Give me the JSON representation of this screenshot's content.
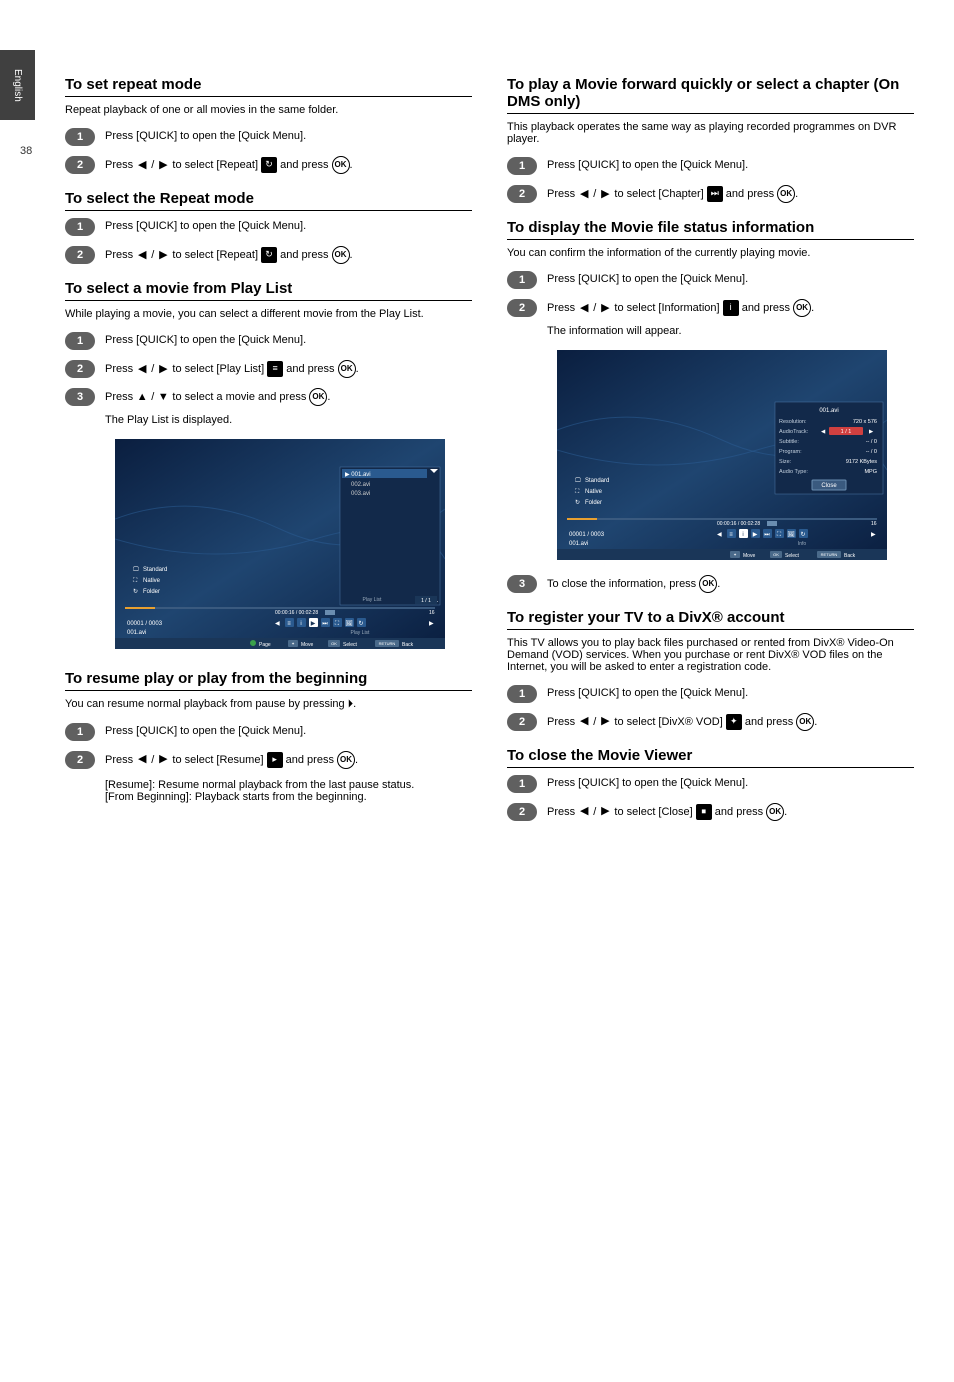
{
  "sidebar": {
    "label": "English",
    "page": "38"
  },
  "left": {
    "sec1": {
      "title": "To set repeat mode",
      "sub": "Repeat playback of one or all movies in the same folder.",
      "s1": "Press [QUICK] to open the [Quick Menu].",
      "s2a": "Press ",
      "s2b": " / ",
      "s2c": " to select [Repeat] ",
      "s2d": " and press "
    },
    "sec2": {
      "title": "To select the Repeat mode",
      "s1": "Press [QUICK] to open the [Quick Menu].",
      "s2a": "Press ",
      "s2b": " / ",
      "s2c": " to select [Repeat] ",
      "s2d": " and press "
    },
    "sec3": {
      "title": "To select a movie from Play List",
      "sub": "While playing a movie, you can select a different movie from the Play List.",
      "s1": "Press [QUICK] to open the [Quick Menu].",
      "s2a": "Press ",
      "s2b": " / ",
      "s2c": " to select [Play List] ",
      "s2d": " and press ",
      "s3a": "Press ",
      "s3b": " / ",
      "s3c": " to select a movie and press ",
      "s3_note": "The Play List is displayed."
    },
    "sec4": {
      "title": "To resume play or play from the beginning",
      "sub": "You can resume normal playback from pause by pressing ⏵.",
      "s1": "Press [QUICK] to open the [Quick Menu].",
      "s2a": "Press ",
      "s2b": " / ",
      "s2c": " to select [Resume] ",
      "s2d": " and press ",
      "note": "[Resume]: Resume normal playback from the last pause status.\n[From Beginning]: Playback starts from the beginning."
    }
  },
  "right": {
    "sec5": {
      "title": "To play a Movie forward quickly or select a chapter (On DMS only)",
      "sub": "This playback operates the same way as playing recorded programmes on DVR player.",
      "s1": "Press [QUICK] to open the [Quick Menu].",
      "s2a": "Press ",
      "s2b": " / ",
      "s2c": " to select [Chapter] ",
      "s2d": " and press "
    },
    "sec6": {
      "title": "To display the Movie file status information",
      "sub": "You can confirm the information of the currently playing movie.",
      "s1": "Press [QUICK] to open the [Quick Menu].",
      "s2a": "Press ",
      "s2b": " / ",
      "s2c": " to select [Information] ",
      "s2d": " and press ",
      "s2_note": "The information will appear.",
      "s3a": "To close the information, press "
    },
    "sec7": {
      "title": "To register your TV to a DivX® account",
      "sub": "This TV allows you to play back files purchased or rented from DivX® Video-On Demand (VOD) services. When you purchase or rent DivX® VOD files on the Internet, you will be asked to enter a registration code.",
      "s1": "Press [QUICK] to open the [Quick Menu].",
      "s2a": "Press ",
      "s2b": " / ",
      "s2c": " to select [DivX® VOD] ",
      "s2d": " and press "
    },
    "sec8": {
      "title": "To close the Movie Viewer",
      "s1": "Press [QUICK] to open the [Quick Menu].",
      "s2a": "Press ",
      "s2b": " / ",
      "s2c": " to select [Close] ",
      "s2d": " and press"
    }
  },
  "ss1": {
    "left_info": [
      "Standard",
      "Native",
      "Folder"
    ],
    "playlist_header": "Play List",
    "items": [
      "001.avi",
      "002.avi",
      "003.avi"
    ],
    "page_indicator": "1 / 1",
    "time": "00:00:16 / 00:02:28",
    "counter": "00001 / 0003",
    "current": "001.avi",
    "vol": "16",
    "btn_page": "Page",
    "btn_move": "Move",
    "btn_ok": "OK",
    "btn_select": "Select",
    "btn_return": "RETURN",
    "btn_back": "Back"
  },
  "ss2": {
    "left_info": [
      "Standard",
      "Native",
      "Folder"
    ],
    "info_title": "001.avi",
    "info_labels": [
      "Resolution:",
      "AudioTrack:",
      "Subtitle:",
      "Program:",
      "Size:",
      "Audio Type:"
    ],
    "info_vals": [
      "720 x 576",
      "1 / 1",
      "-- / 0",
      "-- / 0",
      "9172 KBytes",
      "MPG"
    ],
    "close": "Close",
    "time": "00:00:16 / 00:02:28",
    "counter": "00001 / 0003",
    "current": "001.avi",
    "vol": "16",
    "info_label": "Info",
    "btn_move": "Move",
    "btn_ok": "OK",
    "btn_select": "Select",
    "btn_return": "RETURN",
    "btn_back": "Back"
  }
}
